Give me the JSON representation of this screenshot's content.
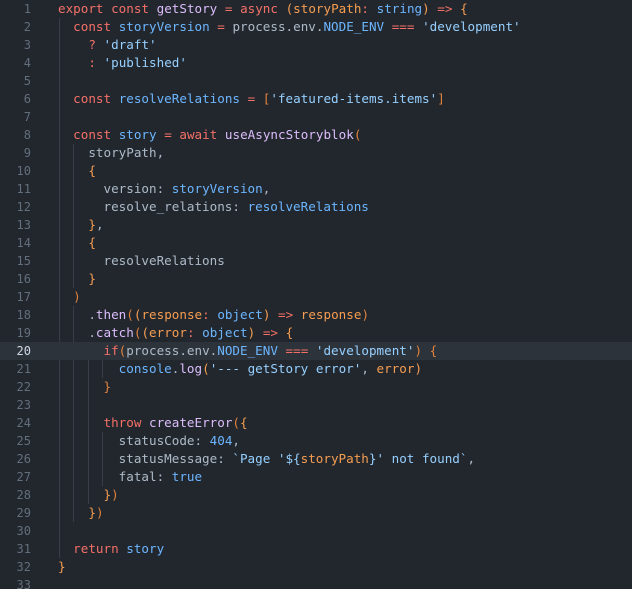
{
  "editor": {
    "active_line": 20,
    "colors": {
      "background": "#22272e",
      "active_line_bg": "#2d333b",
      "keyword": "#f47067",
      "function": "#dcbdfb",
      "variable": "#6cb6ff",
      "parameter": "#f69d50",
      "string": "#96d0ff",
      "plain": "#adbac7",
      "line_number": "#636e7b"
    },
    "lines": [
      {
        "n": "1",
        "tokens": [
          [
            "kw",
            "export"
          ],
          [
            "txt",
            " "
          ],
          [
            "kw",
            "const"
          ],
          [
            "txt",
            " "
          ],
          [
            "fn",
            "getStory"
          ],
          [
            "txt",
            " "
          ],
          [
            "kw",
            "="
          ],
          [
            "txt",
            " "
          ],
          [
            "kw",
            "async"
          ],
          [
            "txt",
            " "
          ],
          [
            "b1",
            "("
          ],
          [
            "par",
            "storyPath"
          ],
          [
            "kw",
            ":"
          ],
          [
            "txt",
            " "
          ],
          [
            "var",
            "string"
          ],
          [
            "b1",
            ")"
          ],
          [
            "txt",
            " "
          ],
          [
            "kw",
            "=>"
          ],
          [
            "txt",
            " "
          ],
          [
            "b1",
            "{"
          ]
        ]
      },
      {
        "n": "2",
        "tokens": [
          [
            "txt",
            "  "
          ],
          [
            "kw",
            "const"
          ],
          [
            "txt",
            " "
          ],
          [
            "var",
            "storyVersion"
          ],
          [
            "txt",
            " "
          ],
          [
            "kw",
            "="
          ],
          [
            "txt",
            " process.env."
          ],
          [
            "var",
            "NODE_ENV"
          ],
          [
            "txt",
            " "
          ],
          [
            "kw",
            "==="
          ],
          [
            "txt",
            " "
          ],
          [
            "str",
            "'development'"
          ]
        ]
      },
      {
        "n": "3",
        "tokens": [
          [
            "txt",
            "    "
          ],
          [
            "kw",
            "?"
          ],
          [
            "txt",
            " "
          ],
          [
            "str",
            "'draft'"
          ]
        ]
      },
      {
        "n": "4",
        "tokens": [
          [
            "txt",
            "    "
          ],
          [
            "kw",
            ":"
          ],
          [
            "txt",
            " "
          ],
          [
            "str",
            "'published'"
          ]
        ]
      },
      {
        "n": "5",
        "tokens": []
      },
      {
        "n": "6",
        "tokens": [
          [
            "txt",
            "  "
          ],
          [
            "kw",
            "const"
          ],
          [
            "txt",
            " "
          ],
          [
            "var",
            "resolveRelations"
          ],
          [
            "txt",
            " "
          ],
          [
            "kw",
            "="
          ],
          [
            "txt",
            " "
          ],
          [
            "b2",
            "["
          ],
          [
            "str",
            "'featured-items.items'"
          ],
          [
            "b2",
            "]"
          ]
        ]
      },
      {
        "n": "7",
        "tokens": []
      },
      {
        "n": "8",
        "tokens": [
          [
            "txt",
            "  "
          ],
          [
            "kw",
            "const"
          ],
          [
            "txt",
            " "
          ],
          [
            "var",
            "story"
          ],
          [
            "txt",
            " "
          ],
          [
            "kw",
            "="
          ],
          [
            "txt",
            " "
          ],
          [
            "kw",
            "await"
          ],
          [
            "txt",
            " "
          ],
          [
            "fn",
            "useAsyncStoryblok"
          ],
          [
            "b2",
            "("
          ]
        ]
      },
      {
        "n": "9",
        "tokens": [
          [
            "txt",
            "    storyPath,"
          ]
        ]
      },
      {
        "n": "10",
        "tokens": [
          [
            "txt",
            "    "
          ],
          [
            "b1",
            "{"
          ]
        ]
      },
      {
        "n": "11",
        "tokens": [
          [
            "txt",
            "      version: "
          ],
          [
            "var",
            "storyVersion"
          ],
          [
            "txt",
            ","
          ]
        ]
      },
      {
        "n": "12",
        "tokens": [
          [
            "txt",
            "      resolve_relations: "
          ],
          [
            "var",
            "resolveRelations"
          ]
        ]
      },
      {
        "n": "13",
        "tokens": [
          [
            "txt",
            "    "
          ],
          [
            "b1",
            "}"
          ],
          [
            "txt",
            ","
          ]
        ]
      },
      {
        "n": "14",
        "tokens": [
          [
            "txt",
            "    "
          ],
          [
            "b1",
            "{"
          ]
        ]
      },
      {
        "n": "15",
        "tokens": [
          [
            "txt",
            "      resolveRelations"
          ]
        ]
      },
      {
        "n": "16",
        "tokens": [
          [
            "txt",
            "    "
          ],
          [
            "b1",
            "}"
          ]
        ]
      },
      {
        "n": "17",
        "tokens": [
          [
            "txt",
            "  "
          ],
          [
            "b2",
            ")"
          ]
        ]
      },
      {
        "n": "18",
        "tokens": [
          [
            "txt",
            "    ."
          ],
          [
            "fn",
            "then"
          ],
          [
            "b2",
            "("
          ],
          [
            "b1",
            "("
          ],
          [
            "par",
            "response"
          ],
          [
            "kw",
            ":"
          ],
          [
            "txt",
            " "
          ],
          [
            "var",
            "object"
          ],
          [
            "b1",
            ")"
          ],
          [
            "txt",
            " "
          ],
          [
            "kw",
            "=>"
          ],
          [
            "txt",
            " "
          ],
          [
            "par",
            "response"
          ],
          [
            "b2",
            ")"
          ]
        ]
      },
      {
        "n": "19",
        "tokens": [
          [
            "txt",
            "    ."
          ],
          [
            "fn",
            "catch"
          ],
          [
            "b2",
            "("
          ],
          [
            "b1",
            "("
          ],
          [
            "par",
            "error"
          ],
          [
            "kw",
            ":"
          ],
          [
            "txt",
            " "
          ],
          [
            "var",
            "object"
          ],
          [
            "b1",
            ")"
          ],
          [
            "txt",
            " "
          ],
          [
            "kw",
            "=>"
          ],
          [
            "txt",
            " "
          ],
          [
            "b1",
            "{"
          ]
        ]
      },
      {
        "n": "20",
        "tokens": [
          [
            "txt",
            "      "
          ],
          [
            "kw",
            "if"
          ],
          [
            "b2",
            "("
          ],
          [
            "txt",
            "process.env."
          ],
          [
            "var",
            "NODE_ENV"
          ],
          [
            "txt",
            " "
          ],
          [
            "kw",
            "==="
          ],
          [
            "txt",
            " "
          ],
          [
            "str",
            "'development'"
          ],
          [
            "b2",
            ")"
          ],
          [
            "txt",
            " "
          ],
          [
            "b2",
            "{"
          ]
        ]
      },
      {
        "n": "21",
        "tokens": [
          [
            "txt",
            "        "
          ],
          [
            "var",
            "console"
          ],
          [
            "txt",
            "."
          ],
          [
            "fn",
            "log"
          ],
          [
            "b1",
            "("
          ],
          [
            "str",
            "'--- getStory error'"
          ],
          [
            "txt",
            ", "
          ],
          [
            "par",
            "error"
          ],
          [
            "b1",
            ")"
          ]
        ]
      },
      {
        "n": "22",
        "tokens": [
          [
            "txt",
            "      "
          ],
          [
            "b2",
            "}"
          ]
        ]
      },
      {
        "n": "23",
        "tokens": []
      },
      {
        "n": "24",
        "tokens": [
          [
            "txt",
            "      "
          ],
          [
            "kw",
            "throw"
          ],
          [
            "txt",
            " "
          ],
          [
            "fn",
            "createError"
          ],
          [
            "b2",
            "("
          ],
          [
            "b1",
            "{"
          ]
        ]
      },
      {
        "n": "25",
        "tokens": [
          [
            "txt",
            "        statusCode: "
          ],
          [
            "num",
            "404"
          ],
          [
            "txt",
            ","
          ]
        ]
      },
      {
        "n": "26",
        "tokens": [
          [
            "txt",
            "        statusMessage: "
          ],
          [
            "str",
            "`Page '${"
          ],
          [
            "par",
            "storyPath"
          ],
          [
            "str",
            "}' not found`"
          ],
          [
            "txt",
            ","
          ]
        ]
      },
      {
        "n": "27",
        "tokens": [
          [
            "txt",
            "        fatal: "
          ],
          [
            "num",
            "true"
          ]
        ]
      },
      {
        "n": "28",
        "tokens": [
          [
            "txt",
            "      "
          ],
          [
            "b1",
            "}"
          ],
          [
            "b2",
            ")"
          ]
        ]
      },
      {
        "n": "29",
        "tokens": [
          [
            "txt",
            "    "
          ],
          [
            "b1",
            "}"
          ],
          [
            "b2",
            ")"
          ]
        ]
      },
      {
        "n": "30",
        "tokens": []
      },
      {
        "n": "31",
        "tokens": [
          [
            "txt",
            "  "
          ],
          [
            "kw",
            "return"
          ],
          [
            "txt",
            " "
          ],
          [
            "var",
            "story"
          ]
        ]
      },
      {
        "n": "32",
        "tokens": [
          [
            "b1",
            "}"
          ]
        ]
      },
      {
        "n": "33",
        "tokens": []
      }
    ]
  }
}
